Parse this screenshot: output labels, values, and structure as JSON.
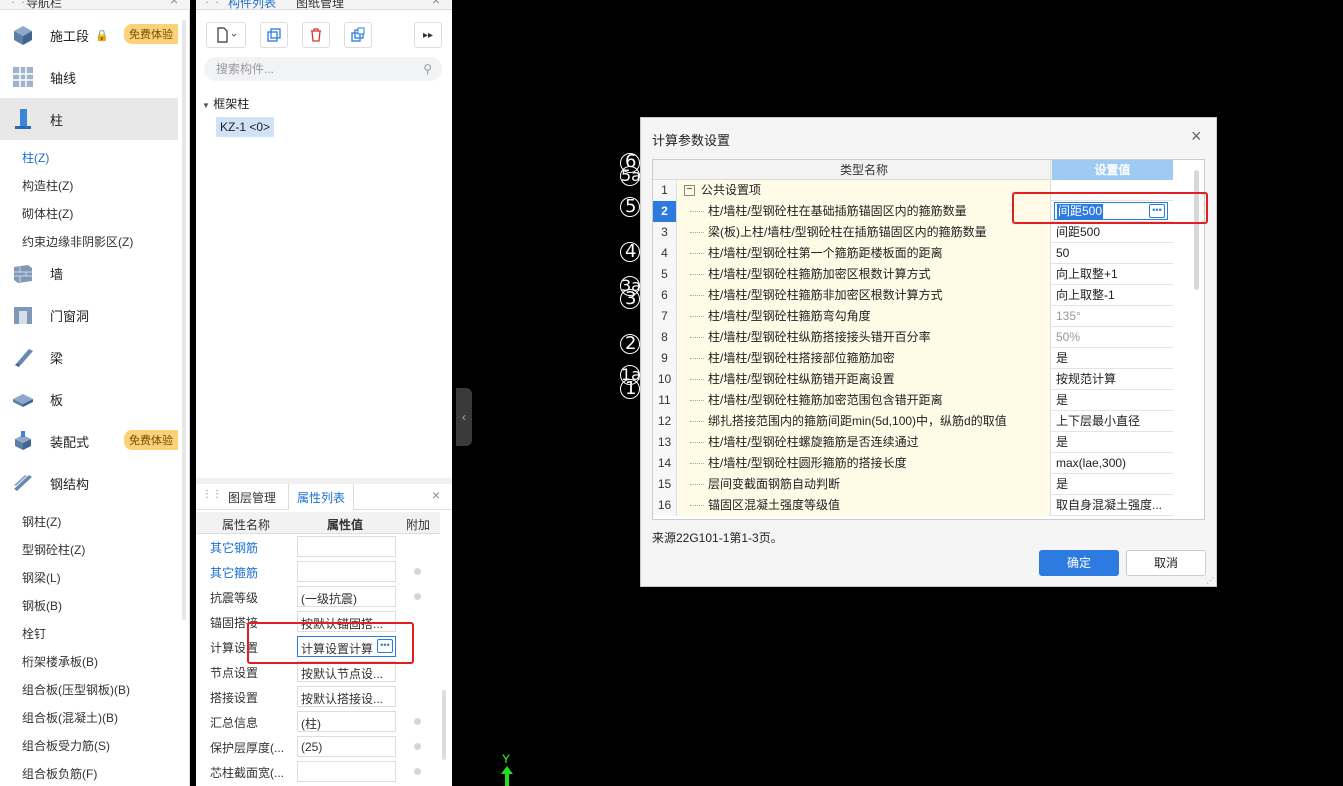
{
  "nav": {
    "title": "导航栏",
    "categories": [
      {
        "label": "施工段",
        "icon": "cube-icon",
        "locked": true,
        "badge": "免费体验"
      },
      {
        "label": "轴线",
        "icon": "grid-icon"
      },
      {
        "label": "柱",
        "icon": "column-icon",
        "active": true
      },
      {
        "label": "墙",
        "icon": "wall-icon"
      },
      {
        "label": "门窗洞",
        "icon": "door-icon"
      },
      {
        "label": "梁",
        "icon": "beam-icon"
      },
      {
        "label": "板",
        "icon": "slab-icon"
      },
      {
        "label": "装配式",
        "icon": "prefab-icon",
        "badge": "免费体验"
      },
      {
        "label": "钢结构",
        "icon": "steel-icon"
      }
    ],
    "column_items": [
      "柱(Z)",
      "构造柱(Z)",
      "砌体柱(Z)",
      "约束边缘非阴影区(Z)"
    ],
    "steel_items": [
      "钢柱(Z)",
      "型钢砼柱(Z)",
      "钢梁(L)",
      "钢板(B)",
      "栓钉",
      "桁架楼承板(B)",
      "组合板(压型钢板)(B)",
      "组合板(混凝土)(B)",
      "组合板受力筋(S)",
      "组合板负筋(F)"
    ]
  },
  "component_panel": {
    "tabs": [
      "构件列表",
      "图纸管理"
    ],
    "search_placeholder": "搜索构件...",
    "tree_root": "框架柱",
    "tree_item": "KZ-1 <0>"
  },
  "property_panel": {
    "tabs": [
      "图层管理",
      "属性列表"
    ],
    "headers": [
      "属性名称",
      "属性值",
      "附加"
    ],
    "rows": [
      {
        "name": "其它钢筋",
        "value": "",
        "link": true,
        "attach": false
      },
      {
        "name": "其它箍筋",
        "value": "",
        "link": true,
        "attach": true
      },
      {
        "name": "抗震等级",
        "value": "(一级抗震)",
        "attach": true
      },
      {
        "name": "锚固搭接",
        "value": "按默认锚固搭...",
        "attach": false
      },
      {
        "name": "计算设置",
        "value": "计算设置计算",
        "attach": false,
        "editing": true
      },
      {
        "name": "节点设置",
        "value": "按默认节点设...",
        "attach": false
      },
      {
        "name": "搭接设置",
        "value": "按默认搭接设...",
        "attach": false
      },
      {
        "name": "汇总信息",
        "value": "(柱)",
        "attach": true
      },
      {
        "name": "保护层厚度(...",
        "value": "(25)",
        "attach": true
      },
      {
        "name": "芯柱截面宽(...",
        "value": "",
        "attach": true
      }
    ]
  },
  "canvas": {
    "axis_labels": [
      "6",
      "5a",
      "5",
      "4",
      "3a",
      "3",
      "2",
      "1a",
      "1"
    ],
    "y_axis": "Y"
  },
  "dialog": {
    "title": "计算参数设置",
    "col_name": "类型名称",
    "col_value": "设置值",
    "rows": [
      {
        "num": "1",
        "name": "公共设置项",
        "value": "",
        "group": true
      },
      {
        "num": "2",
        "name": "柱/墙柱/型钢砼柱在基础插筋锚固区内的箍筋数量",
        "value": "间距500",
        "selected": true
      },
      {
        "num": "3",
        "name": "梁(板)上柱/墙柱/型钢砼柱在插筋锚固区内的箍筋数量",
        "value": "间距500"
      },
      {
        "num": "4",
        "name": "柱/墙柱/型钢砼柱第一个箍筋距楼板面的距离",
        "value": "50"
      },
      {
        "num": "5",
        "name": "柱/墙柱/型钢砼柱箍筋加密区根数计算方式",
        "value": "向上取整+1"
      },
      {
        "num": "6",
        "name": "柱/墙柱/型钢砼柱箍筋非加密区根数计算方式",
        "value": "向上取整-1"
      },
      {
        "num": "7",
        "name": "柱/墙柱/型钢砼柱箍筋弯勾角度",
        "value": "135°",
        "dim": true
      },
      {
        "num": "8",
        "name": "柱/墙柱/型钢砼柱纵筋搭接接头错开百分率",
        "value": "50%",
        "dim": true
      },
      {
        "num": "9",
        "name": "柱/墙柱/型钢砼柱搭接部位箍筋加密",
        "value": "是"
      },
      {
        "num": "10",
        "name": "柱/墙柱/型钢砼柱纵筋错开距离设置",
        "value": "按规范计算"
      },
      {
        "num": "11",
        "name": "柱/墙柱/型钢砼柱箍筋加密范围包含错开距离",
        "value": "是"
      },
      {
        "num": "12",
        "name": "绑扎搭接范围内的箍筋间距min(5d,100)中，纵筋d的取值",
        "value": "上下层最小直径"
      },
      {
        "num": "13",
        "name": "柱/墙柱/型钢砼柱螺旋箍筋是否连续通过",
        "value": "是"
      },
      {
        "num": "14",
        "name": "柱/墙柱/型钢砼柱圆形箍筋的搭接长度",
        "value": "max(lae,300)"
      },
      {
        "num": "15",
        "name": "层间变截面钢筋自动判断",
        "value": "是"
      },
      {
        "num": "16",
        "name": "锚固区混凝土强度等级值",
        "value": "取自身混凝土强度..."
      }
    ],
    "source": "来源22G101-1第1-3页。",
    "ok": "确定",
    "cancel": "取消"
  }
}
